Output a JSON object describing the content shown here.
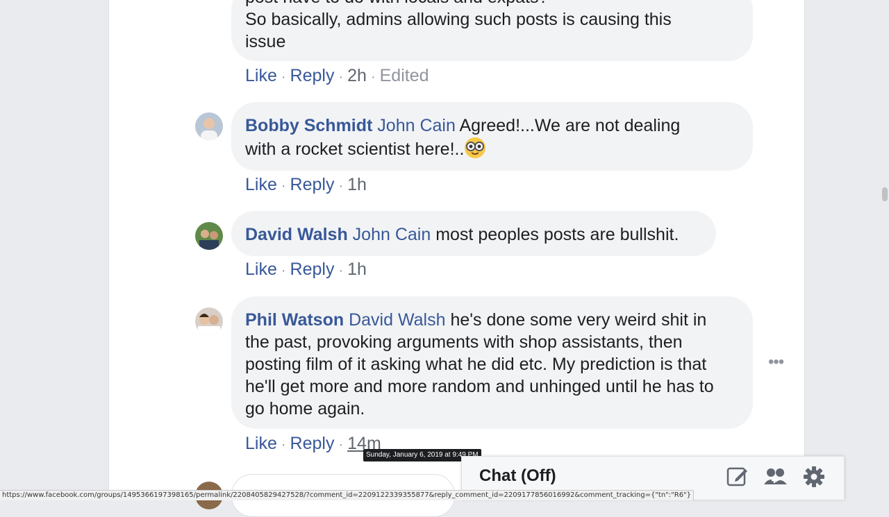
{
  "comments": [
    {
      "text_lines": [
        "post have to do with locals and expats?",
        "So basically, admins allowing such posts is causing this",
        "issue"
      ],
      "like": "Like",
      "reply": "Reply",
      "time": "2h",
      "edited": "Edited"
    },
    {
      "author": "Bobby Schmidt",
      "mention": "John Cain",
      "text_a": "Agreed!...We are not dealing",
      "text_b": "with a rocket scientist here!..",
      "emoji": "nerd-face-emoji",
      "like": "Like",
      "reply": "Reply",
      "time": "1h"
    },
    {
      "author": "David Walsh",
      "mention": "John Cain",
      "text": "most peoples posts are bullshit.",
      "like": "Like",
      "reply": "Reply",
      "time": "1h"
    },
    {
      "author": "Phil Watson",
      "mention": "David Walsh",
      "text_lines": [
        "he's done some very weird shit in",
        "the past, provoking arguments with shop assistants, then",
        "posting film of it asking what he did etc. My prediction is that",
        "he'll get more and more random and unhinged until he has to",
        "go home again."
      ],
      "like": "Like",
      "reply": "Reply",
      "time": "14m"
    }
  ],
  "tooltip": "Sunday, January 6, 2019 at 9:49 PM",
  "chat": {
    "title": "Chat (Off)",
    "icons": [
      "compose-icon",
      "create-group-icon",
      "settings-gear-icon"
    ]
  },
  "status_url": "https://www.facebook.com/groups/1495366197398165/permalink/2208405829427528/?comment_id=2209122339355877&reply_comment_id=2209177856016992&comment_tracking={\"tn\":\"R6\"}",
  "colors": {
    "link": "#385898",
    "bubble": "#f2f3f5",
    "page_bg": "#e9ebee"
  }
}
